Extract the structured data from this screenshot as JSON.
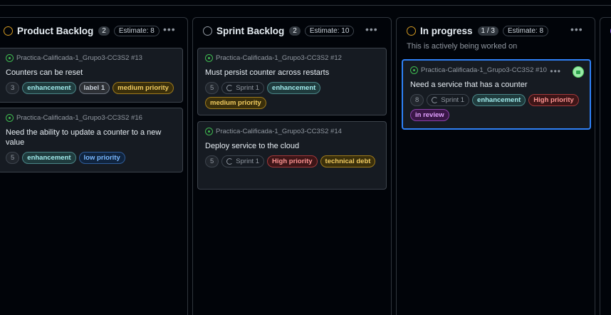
{
  "colors": {
    "open_green": "#3fb950",
    "selected_border": "#2f81f7",
    "backlog_circle": "#d29922",
    "sprint_circle": "#9198a1",
    "progress_circle": "#d29922"
  },
  "columns": [
    {
      "title": "Product Backlog",
      "count": "2",
      "estimate": "Estimate: 8",
      "menu": "•••",
      "cards": [
        {
          "repo": "Practica-Calificada-1_Grupo3-CC3S2 #13",
          "title": "Counters can be reset",
          "estimate": "3",
          "labels": [
            "enhancement",
            "label 1",
            "medium priority"
          ]
        },
        {
          "repo": "Practica-Calificada-1_Grupo3-CC3S2 #16",
          "title": "Need the ability to update a counter to a new value",
          "estimate": "5",
          "labels": [
            "enhancement",
            "low priority"
          ]
        }
      ]
    },
    {
      "title": "Sprint Backlog",
      "count": "2",
      "estimate": "Estimate: 10",
      "menu": "•••",
      "cards": [
        {
          "repo": "Practica-Calificada-1_Grupo3-CC3S2 #12",
          "title": "Must persist counter across restarts",
          "estimate": "5",
          "sprint": "Sprint 1",
          "labels": [
            "enhancement",
            "medium priority"
          ]
        },
        {
          "repo": "Practica-Calificada-1_Grupo3-CC3S2 #14",
          "title": "Deploy service to the cloud",
          "estimate": "5",
          "sprint": "Sprint 1",
          "labels": [
            "High priority",
            "technical debt"
          ]
        }
      ]
    },
    {
      "title": "In progress",
      "count": "1 / 3",
      "estimate": "Estimate: 8",
      "menu": "•••",
      "description": "This is actively being worked on",
      "cards": [
        {
          "repo": "Practica-Calificada-1_Grupo3-CC3S2 #10",
          "title": "Need a service that has a counter",
          "estimate": "8",
          "sprint": "Sprint 1",
          "menu": "•••",
          "labels": [
            "enhancement",
            "High priority",
            "in review"
          ]
        }
      ]
    }
  ],
  "label_colors": {
    "enhancement": {
      "bg": "#1f3b3d",
      "fg": "#a2eeef",
      "border": "#4a8587"
    },
    "label 1": {
      "bg": "#2d3035",
      "fg": "#c9d1d9",
      "border": "#6e7681"
    },
    "medium priority": {
      "bg": "#3a2f0b",
      "fg": "#f2cc60",
      "border": "#9e7a1c"
    },
    "low priority": {
      "bg": "#10243e",
      "fg": "#79b8ff",
      "border": "#2f5d9a"
    },
    "High priority": {
      "bg": "#3d1517",
      "fg": "#ff9492",
      "border": "#a0393b"
    },
    "technical debt": {
      "bg": "#3a2f0b",
      "fg": "#f2cc60",
      "border": "#9e7a1c"
    },
    "in review": {
      "bg": "#3a1747",
      "fg": "#e2a0ff",
      "border": "#8a3fa8"
    }
  }
}
